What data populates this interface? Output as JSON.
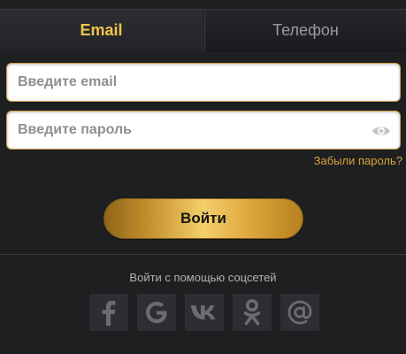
{
  "tabs": [
    {
      "label": "Email",
      "active": true
    },
    {
      "label": "Телефон",
      "active": false
    }
  ],
  "form": {
    "email_placeholder": "Введите email",
    "password_placeholder": "Введите пароль",
    "forgot_label": "Забыли пароль?",
    "login_label": "Войти"
  },
  "social": {
    "label": "Войти с помощью соцсетей",
    "providers": [
      {
        "name": "facebook-icon"
      },
      {
        "name": "google-icon"
      },
      {
        "name": "vk-icon"
      },
      {
        "name": "odnoklassniki-icon"
      },
      {
        "name": "mail-at-icon"
      }
    ]
  },
  "colors": {
    "background": "#1e1f21",
    "accent_gold": "#f0c44c",
    "link": "#d9a53a",
    "icon_gray": "#6b6c70"
  }
}
